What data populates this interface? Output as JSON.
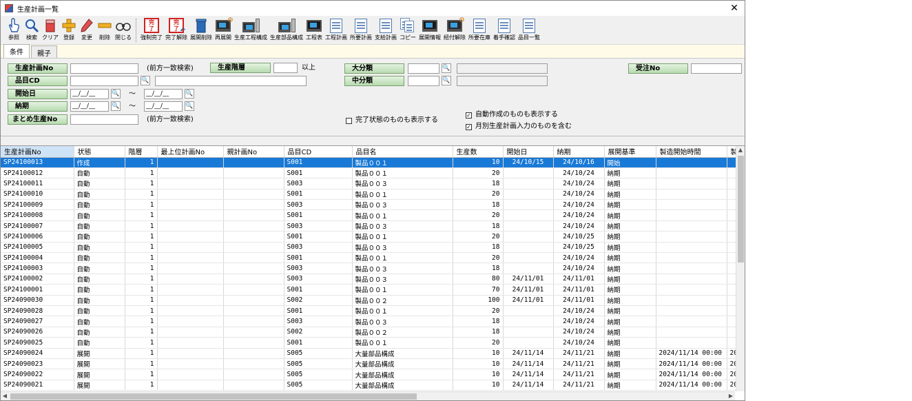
{
  "window": {
    "title": "生産計画一覧",
    "close": "✕"
  },
  "toolbar": [
    {
      "label": "参照",
      "icon": "hand-icon"
    },
    {
      "label": "検索",
      "icon": "magnifier-icon"
    },
    {
      "label": "クリア",
      "icon": "eraser-icon"
    },
    {
      "label": "登録",
      "icon": "plus-icon"
    },
    {
      "label": "変更",
      "icon": "pencil-icon"
    },
    {
      "label": "削除",
      "icon": "minus-icon"
    },
    {
      "label": "閉じる",
      "icon": "binoculars-icon"
    },
    {
      "label": "強制完了",
      "icon": "complete-stamp-icon"
    },
    {
      "label": "完了解除",
      "icon": "complete-cancel-stamp-icon"
    },
    {
      "label": "展開削除",
      "icon": "trash-icon"
    },
    {
      "label": "再展開",
      "icon": "monitor-gear-icon"
    },
    {
      "label": "生産工程構成",
      "icon": "computer-icon"
    },
    {
      "label": "生産部品構成",
      "icon": "computer-icon"
    },
    {
      "label": "工程表",
      "icon": "monitor-icon"
    },
    {
      "label": "工程計画",
      "icon": "document-icon"
    },
    {
      "label": "所要計画",
      "icon": "document-icon"
    },
    {
      "label": "支給計画",
      "icon": "document-icon"
    },
    {
      "label": "コピー",
      "icon": "copy-icon"
    },
    {
      "label": "展開情報",
      "icon": "monitor-icon"
    },
    {
      "label": "紐付解除",
      "icon": "monitor-gear-icon"
    },
    {
      "label": "所要在庫",
      "icon": "document-icon"
    },
    {
      "label": "着手確認",
      "icon": "document-icon"
    },
    {
      "label": "品目一覧",
      "icon": "document-icon"
    }
  ],
  "tabs": [
    {
      "label": "条件"
    },
    {
      "label": "親子"
    }
  ],
  "filter": {
    "plan_no_label": "生産計画No",
    "prefix_note": "(前方一致検索)",
    "level_label": "生産階層",
    "level_suffix": "以上",
    "major_label": "大分類",
    "order_label": "受注No",
    "item_label": "品目CD",
    "middle_label": "中分類",
    "start_label": "開始日",
    "date_placeholder": "__/__/__",
    "tilde": "～",
    "due_label": "納期",
    "summary_label": "まとめ生産No",
    "prefix_note2": "(前方一致検索)",
    "chk_completed": "完了状態のものも表示する",
    "chk_auto": "自動作成のものも表示する",
    "chk_monthly": "月別生産計画入力のものを含む",
    "checked_mark": "✓"
  },
  "grid": {
    "columns": [
      "生産計画No",
      "状態",
      "階層",
      "最上位計画No",
      "親計画No",
      "品目CD",
      "品目名",
      "生産数",
      "開始日",
      "納期",
      "展開基準",
      "製造開始時間",
      "製"
    ],
    "rows": [
      [
        "SP24100013",
        "作成",
        "1",
        "",
        "",
        "S001",
        "製品００１",
        "10",
        "24/10/15",
        "24/10/16",
        "開始",
        "",
        ""
      ],
      [
        "SP24100012",
        "自動",
        "1",
        "",
        "",
        "S001",
        "製品００１",
        "20",
        "",
        "24/10/24",
        "納期",
        "",
        ""
      ],
      [
        "SP24100011",
        "自動",
        "1",
        "",
        "",
        "S003",
        "製品００３",
        "18",
        "",
        "24/10/24",
        "納期",
        "",
        ""
      ],
      [
        "SP24100010",
        "自動",
        "1",
        "",
        "",
        "S001",
        "製品００１",
        "20",
        "",
        "24/10/24",
        "納期",
        "",
        ""
      ],
      [
        "SP24100009",
        "自動",
        "1",
        "",
        "",
        "S003",
        "製品００３",
        "18",
        "",
        "24/10/24",
        "納期",
        "",
        ""
      ],
      [
        "SP24100008",
        "自動",
        "1",
        "",
        "",
        "S001",
        "製品００１",
        "20",
        "",
        "24/10/24",
        "納期",
        "",
        ""
      ],
      [
        "SP24100007",
        "自動",
        "1",
        "",
        "",
        "S003",
        "製品００３",
        "18",
        "",
        "24/10/24",
        "納期",
        "",
        ""
      ],
      [
        "SP24100006",
        "自動",
        "1",
        "",
        "",
        "S001",
        "製品００１",
        "20",
        "",
        "24/10/25",
        "納期",
        "",
        ""
      ],
      [
        "SP24100005",
        "自動",
        "1",
        "",
        "",
        "S003",
        "製品００３",
        "18",
        "",
        "24/10/25",
        "納期",
        "",
        ""
      ],
      [
        "SP24100004",
        "自動",
        "1",
        "",
        "",
        "S001",
        "製品００１",
        "20",
        "",
        "24/10/24",
        "納期",
        "",
        ""
      ],
      [
        "SP24100003",
        "自動",
        "1",
        "",
        "",
        "S003",
        "製品００３",
        "18",
        "",
        "24/10/24",
        "納期",
        "",
        ""
      ],
      [
        "SP24100002",
        "自動",
        "1",
        "",
        "",
        "S003",
        "製品００３",
        "80",
        "24/11/01",
        "24/11/01",
        "納期",
        "",
        ""
      ],
      [
        "SP24100001",
        "自動",
        "1",
        "",
        "",
        "S001",
        "製品００１",
        "70",
        "24/11/01",
        "24/11/01",
        "納期",
        "",
        ""
      ],
      [
        "SP24090030",
        "自動",
        "1",
        "",
        "",
        "S002",
        "製品００２",
        "100",
        "24/11/01",
        "24/11/01",
        "納期",
        "",
        ""
      ],
      [
        "SP24090028",
        "自動",
        "1",
        "",
        "",
        "S001",
        "製品００１",
        "20",
        "",
        "24/10/24",
        "納期",
        "",
        ""
      ],
      [
        "SP24090027",
        "自動",
        "1",
        "",
        "",
        "S003",
        "製品００３",
        "18",
        "",
        "24/10/24",
        "納期",
        "",
        ""
      ],
      [
        "SP24090026",
        "自動",
        "1",
        "",
        "",
        "S002",
        "製品００２",
        "18",
        "",
        "24/10/24",
        "納期",
        "",
        ""
      ],
      [
        "SP24090025",
        "自動",
        "1",
        "",
        "",
        "S001",
        "製品００１",
        "20",
        "",
        "24/10/24",
        "納期",
        "",
        ""
      ],
      [
        "SP24090024",
        "展開",
        "1",
        "",
        "",
        "S005",
        "大量部品構成",
        "10",
        "24/11/14",
        "24/11/21",
        "納期",
        "2024/11/14 00:00",
        "20"
      ],
      [
        "SP24090023",
        "展開",
        "1",
        "",
        "",
        "S005",
        "大量部品構成",
        "10",
        "24/11/14",
        "24/11/21",
        "納期",
        "2024/11/14 00:00",
        "20"
      ],
      [
        "SP24090022",
        "展開",
        "1",
        "",
        "",
        "S005",
        "大量部品構成",
        "10",
        "24/11/14",
        "24/11/21",
        "納期",
        "2024/11/14 00:00",
        "20"
      ],
      [
        "SP24090021",
        "展開",
        "1",
        "",
        "",
        "S005",
        "大量部品構成",
        "10",
        "24/11/14",
        "24/11/21",
        "納期",
        "2024/11/14 00:00",
        "20"
      ]
    ],
    "selected_row": 0
  },
  "scroll": {
    "up": "▲",
    "down": "▼",
    "left": "◀",
    "right": "▶"
  }
}
